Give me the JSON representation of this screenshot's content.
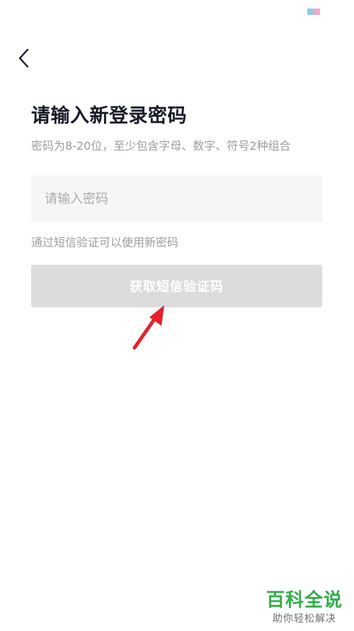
{
  "header": {
    "back_icon": "chevron-left-icon"
  },
  "main": {
    "title": "请输入新登录密码",
    "subtitle": "密码为8-20位，至少包含字母、数字、符号2种组合",
    "password_placeholder": "请输入密码",
    "password_value": "",
    "hint": "通过短信验证可以使用新密码",
    "sms_button_label": "获取短信验证码"
  },
  "watermark": {
    "title": "百科全说",
    "subtitle": "助你轻松解决"
  },
  "colors": {
    "title_text": "#171b26",
    "secondary_text": "#9b9da2",
    "field_background": "#f6f6f6",
    "button_disabled_background": "#dcdcde",
    "button_text": "#ffffff",
    "annotation_arrow": "#e8202a",
    "watermark_green": "#2eb046"
  }
}
